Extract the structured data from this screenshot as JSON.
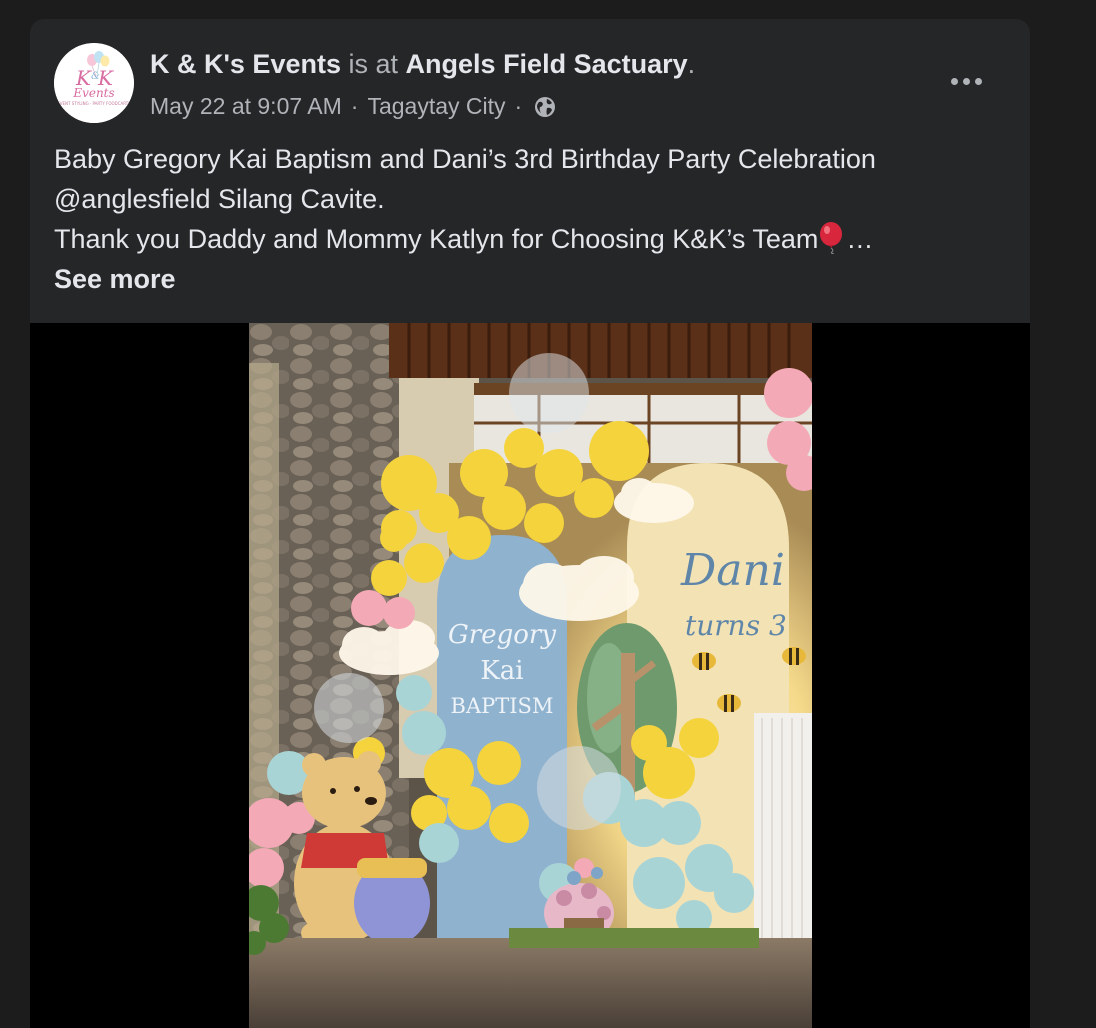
{
  "post": {
    "author": "K & K's Events",
    "is_at": "is at",
    "place": "Angels Field Sactuary",
    "period": ".",
    "date": "May 22 at 9:07 AM",
    "separator": "·",
    "location": "Tagaytay City",
    "audience_icon": "globe-icon",
    "more_icon": "more-options-icon",
    "text_lines": [
      "Baby Gregory Kai Baptism and Dani’s 3rd Birthday Party Celebration",
      "@anglesfield Silang Cavite.",
      "Thank you Daddy and Mommy Katlyn for Choosing K&K’s Team"
    ],
    "ellipsis": "…",
    "see_more": "See more"
  },
  "avatar": {
    "logo_text_1": "K",
    "logo_text_2": "&",
    "logo_text_3": "K",
    "logo_text_4": "Events",
    "logo_tagline": "EVENT STYLING · PARTY FOODCARTS"
  },
  "photo": {
    "arch_left_line1": "Gregory",
    "arch_left_line2": "Kai",
    "arch_left_line3": "BAPTISM",
    "arch_right_line1": "Dani",
    "arch_right_line2": "turns 3"
  },
  "colors": {
    "card_bg": "#252628",
    "text_primary": "#e4e6eb",
    "text_secondary": "#b0b3b8"
  }
}
